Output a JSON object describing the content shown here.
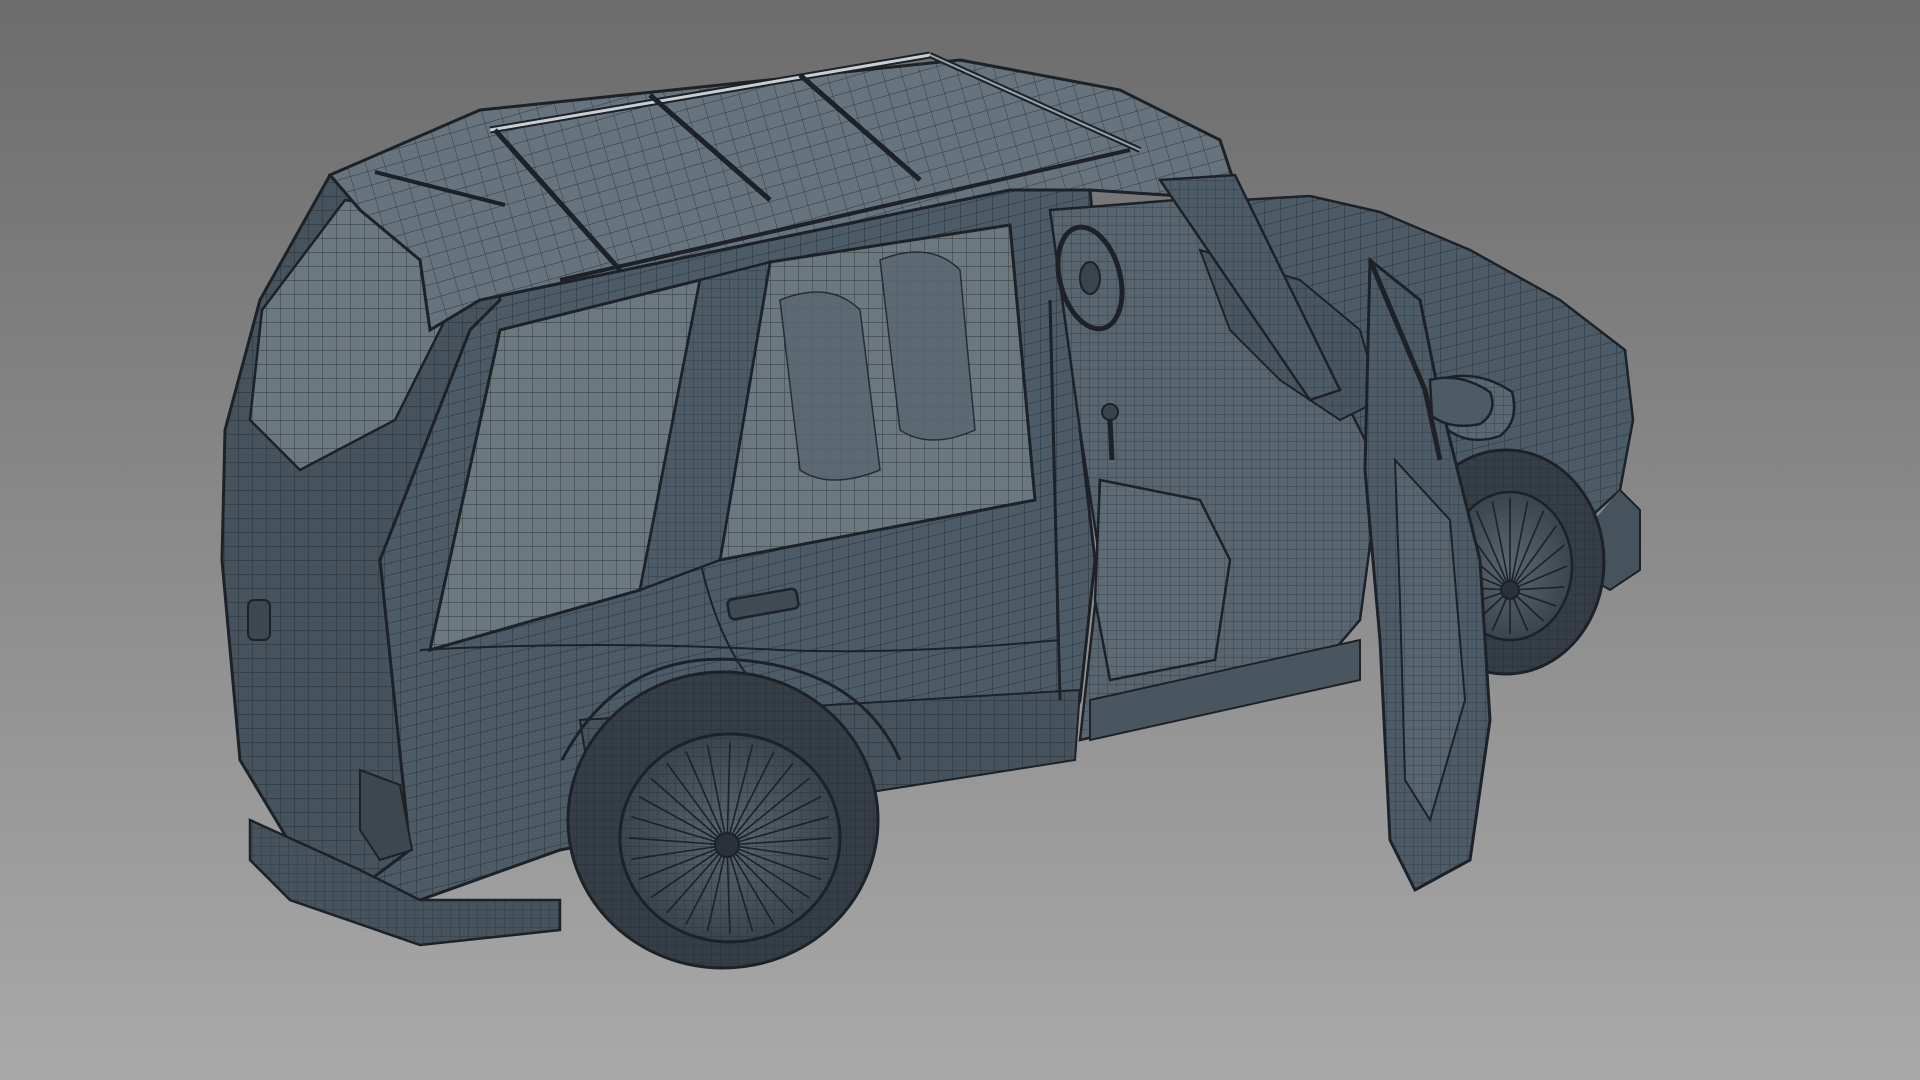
{
  "viewport": {
    "background_top": "#6c6c6c",
    "background_bottom": "#a9a9a9",
    "model": {
      "subject": "suv-wireframe-model",
      "shading": "flat-grey-with-wireframe",
      "body_color": "#4d5b66",
      "body_light_color": "#67747e",
      "window_color": "#6b7880",
      "wire_color": "#1c2228",
      "rim_color": "#3e4952",
      "tire_color": "#353e46",
      "front_door_state": "open"
    }
  }
}
